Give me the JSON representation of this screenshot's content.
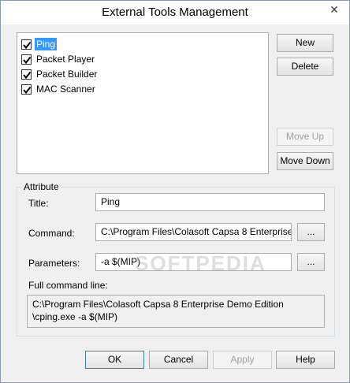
{
  "window": {
    "title": "External Tools Management"
  },
  "tools": [
    {
      "label": "Ping",
      "checked": true,
      "selected": true
    },
    {
      "label": "Packet Player",
      "checked": true,
      "selected": false
    },
    {
      "label": "Packet Builder",
      "checked": true,
      "selected": false
    },
    {
      "label": "MAC Scanner",
      "checked": true,
      "selected": false
    }
  ],
  "side_buttons": {
    "new": "New",
    "delete": "Delete",
    "move_up": "Move Up",
    "move_down": "Move Down"
  },
  "attribute": {
    "group_label": "Attribute",
    "title_label": "Title:",
    "title_value": "Ping",
    "command_label": "Command:",
    "command_value": "C:\\Program Files\\Colasoft Capsa 8 Enterprise",
    "browse_label": "...",
    "parameters_label": "Parameters:",
    "parameters_value": "-a $(MIP)",
    "full_label": "Full command line:",
    "full_line1": "C:\\Program Files\\Colasoft Capsa 8 Enterprise Demo Edition",
    "full_line2": "\\cping.exe -a $(MIP)"
  },
  "footer": {
    "ok": "OK",
    "cancel": "Cancel",
    "apply": "Apply",
    "help": "Help"
  },
  "watermark": "SOFTPEDIA",
  "colors": {
    "selection": "#3399ff",
    "window_bg": "#f0f0f0"
  }
}
